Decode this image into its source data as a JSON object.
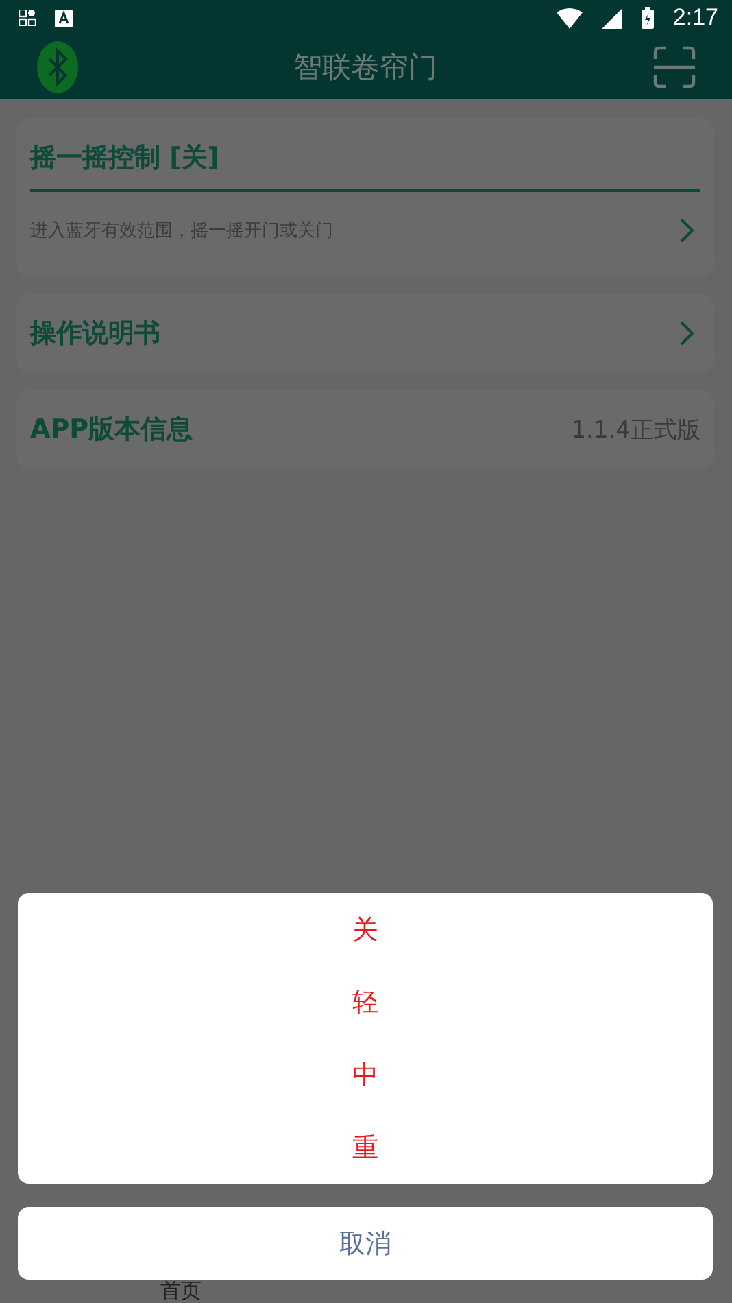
{
  "status_bar": {
    "time": "2:17"
  },
  "header": {
    "title": "智联卷帘门"
  },
  "cards": [
    {
      "kind": "toggle",
      "title": "摇一摇控制 [关]",
      "subtitle": "进入蓝牙有效范围，摇一摇开门或关门"
    },
    {
      "kind": "link",
      "title": "操作说明书"
    },
    {
      "kind": "info",
      "title": "APP版本信息",
      "value": "1.1.4正式版"
    }
  ],
  "action_sheet": {
    "options": [
      "关",
      "轻",
      "中",
      "重"
    ],
    "cancel": "取消"
  },
  "bottom_nav": {
    "label": "首页"
  }
}
